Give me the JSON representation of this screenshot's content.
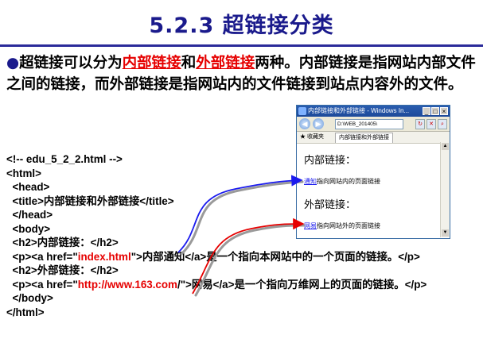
{
  "title": "5.2.3 超链接分类",
  "intro": {
    "bullet": "●",
    "t1": "超链接可以分为",
    "internal": "内部链接",
    "t2": "和",
    "external": "外部链接",
    "t3": "两种。内部链接是指网站内部文件之间的链接，而外部链接是指网站内的文件链接到站点内容外的文件。"
  },
  "code": {
    "l1": "<!-- edu_5_2_2.html -->",
    "l2": "<html>",
    "l3": "  <head>",
    "l4": "  <title>内部链接和外部链接</title>",
    "l5": "  </head>",
    "l6": "  <body>",
    "l7": "  <h2>内部链接：</h2>",
    "l8a": "  <p><a href=\"",
    "l8b": "index.html",
    "l8c": "\">内部通知</a>是一个指向本网站中的一个页面的链接。</p>",
    "l9": "  <h2>外部链接：</h2>",
    "l10a": "  <p><a href=\"",
    "l10b": "http://www.163.com",
    "l10c": "/\">网易</a>是一个指向万维网上的页面的链接。</p>",
    "l11": "  </body>",
    "l12": "</html>"
  },
  "browser": {
    "window_title": "内部链接和外部链接 - Windows In...",
    "min": "_",
    "max": "□",
    "close": "×",
    "address": "D:\\WEB_201405\\",
    "favorites": "收藏夹",
    "tab": "内部链接和外部链接",
    "h2_internal": "内部链接：",
    "link_internal": "通知",
    "text_internal": "指向网站内的页面链接",
    "h2_external": "外部链接：",
    "link_external": "网易",
    "text_external": "指向网站外的页面链接"
  },
  "colors": {
    "title": "#1a1a8c",
    "highlight": "#e60000",
    "arrow_blue": "#1a1aee",
    "arrow_red": "#e60000"
  }
}
